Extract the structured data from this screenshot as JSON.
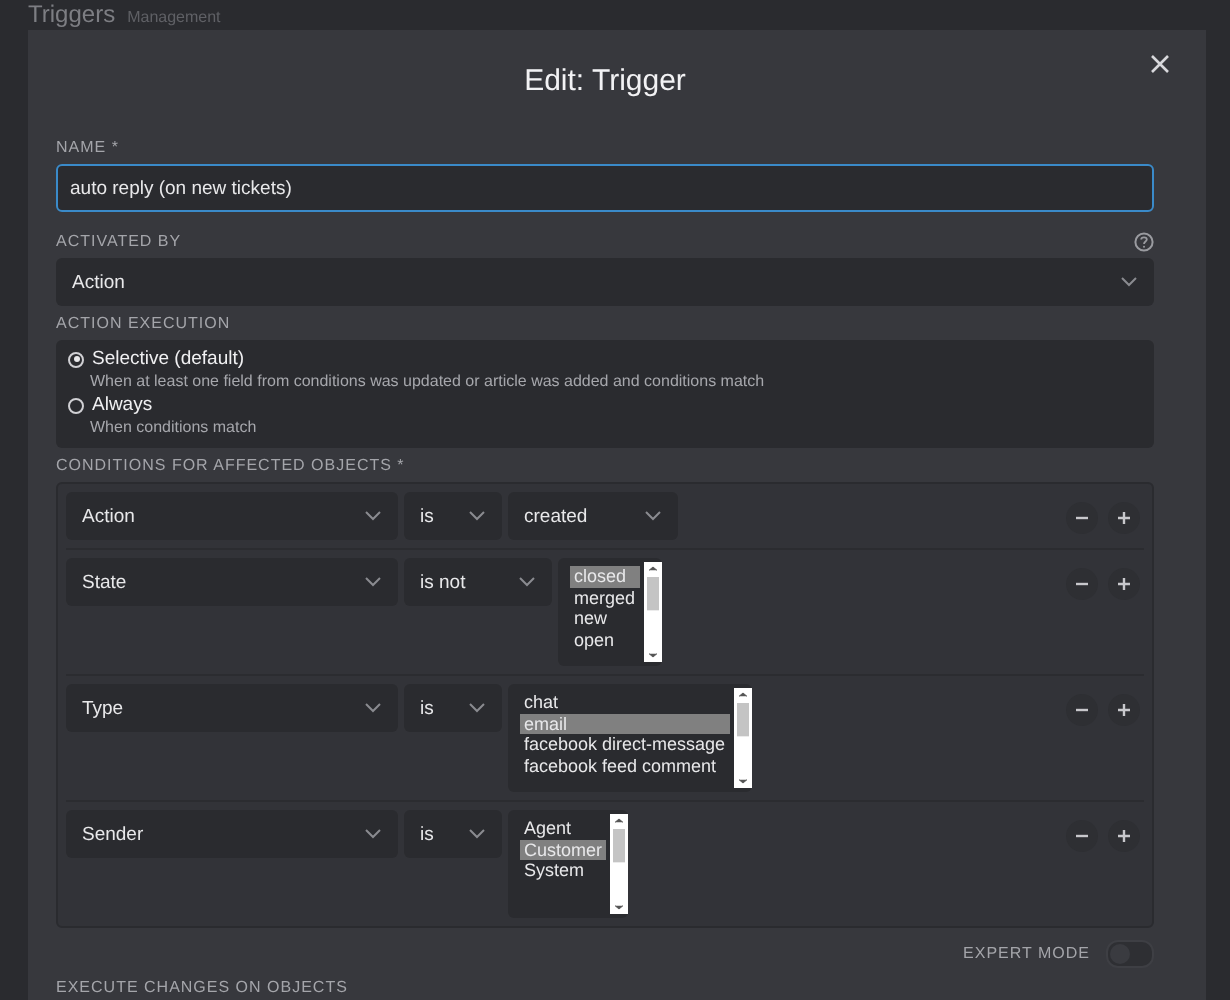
{
  "page": {
    "title": "Triggers",
    "subtitle": "Management"
  },
  "dialog": {
    "title": "Edit: Trigger",
    "name": {
      "label": "NAME *",
      "value": "auto reply (on new tickets)"
    },
    "activated_by": {
      "label": "ACTIVATED BY",
      "value": "Action"
    },
    "action_execution": {
      "label": "ACTION EXECUTION",
      "options": [
        {
          "label": "Selective (default)",
          "description": "When at least one field from conditions was updated or article was added and conditions match",
          "selected": true
        },
        {
          "label": "Always",
          "description": "When conditions match",
          "selected": false
        }
      ]
    },
    "conditions": {
      "label": "CONDITIONS FOR AFFECTED OBJECTS *",
      "rows": [
        {
          "attribute": "Action",
          "operator": "is",
          "kind": "select",
          "value": "created"
        },
        {
          "attribute": "State",
          "operator": "is not",
          "kind": "list",
          "options": [
            {
              "label": "closed",
              "selected": true
            },
            {
              "label": "merged",
              "selected": false
            },
            {
              "label": "new",
              "selected": false
            },
            {
              "label": "open",
              "selected": false
            }
          ]
        },
        {
          "attribute": "Type",
          "operator": "is",
          "kind": "list",
          "options": [
            {
              "label": "chat",
              "selected": false
            },
            {
              "label": "email",
              "selected": true
            },
            {
              "label": "facebook direct-message",
              "selected": false
            },
            {
              "label": "facebook feed comment",
              "selected": false
            }
          ]
        },
        {
          "attribute": "Sender",
          "operator": "is",
          "kind": "list",
          "options": [
            {
              "label": "Agent",
              "selected": false
            },
            {
              "label": "Customer",
              "selected": true
            },
            {
              "label": "System",
              "selected": false
            }
          ]
        }
      ]
    },
    "expert_mode": {
      "label": "EXPERT MODE",
      "on": false
    },
    "next_section": {
      "label": "EXECUTE CHANGES ON OBJECTS"
    }
  }
}
